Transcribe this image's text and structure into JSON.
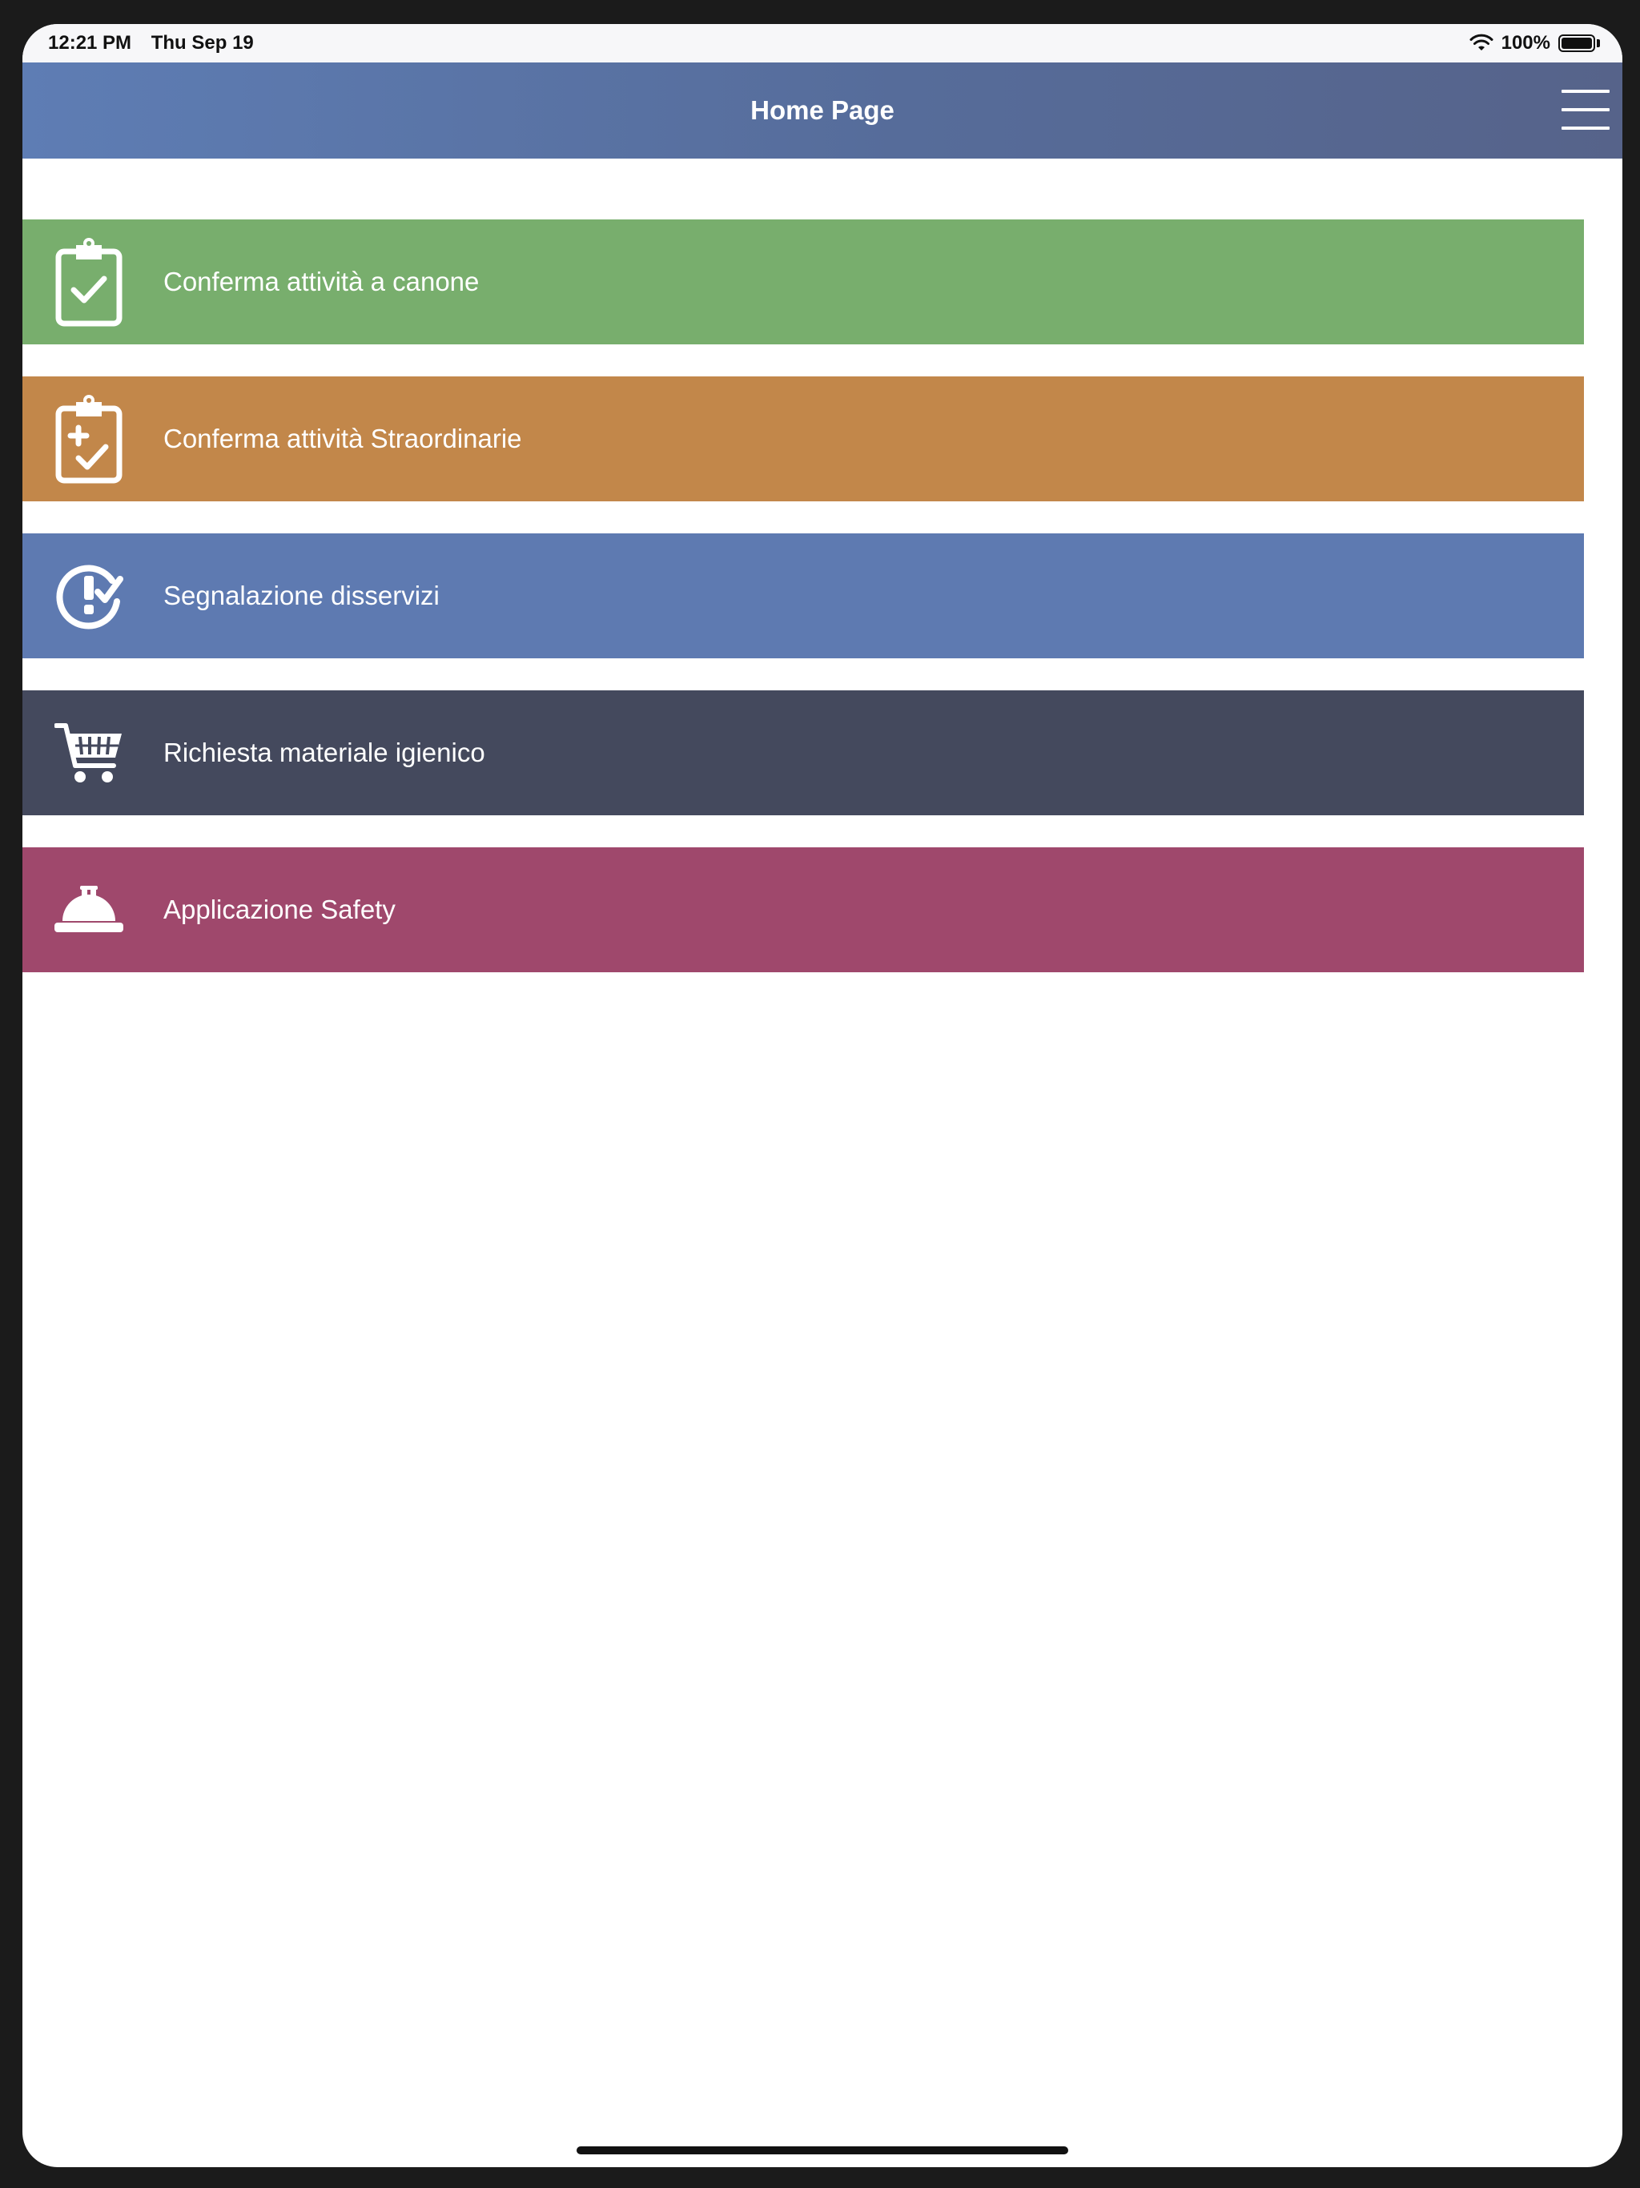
{
  "status_bar": {
    "time": "12:21 PM",
    "date": "Thu Sep 19",
    "battery": "100%"
  },
  "header": {
    "title": "Home Page",
    "menu_icon": "hamburger-menu-icon"
  },
  "menu": [
    {
      "label": "Conferma attività a canone",
      "icon": "clipboard-check-icon",
      "color": "#78ae6d"
    },
    {
      "label": "Conferma attività Straordinarie",
      "icon": "clipboard-plus-check-icon",
      "color": "#c2874a"
    },
    {
      "label": "Segnalazione disservizi",
      "icon": "alert-check-icon",
      "color": "#5e7ab1"
    },
    {
      "label": "Richiesta materiale igienico",
      "icon": "shopping-cart-icon",
      "color": "#44495d"
    },
    {
      "label": "Applicazione Safety",
      "icon": "hard-hat-icon",
      "color": "#9f486c"
    }
  ]
}
